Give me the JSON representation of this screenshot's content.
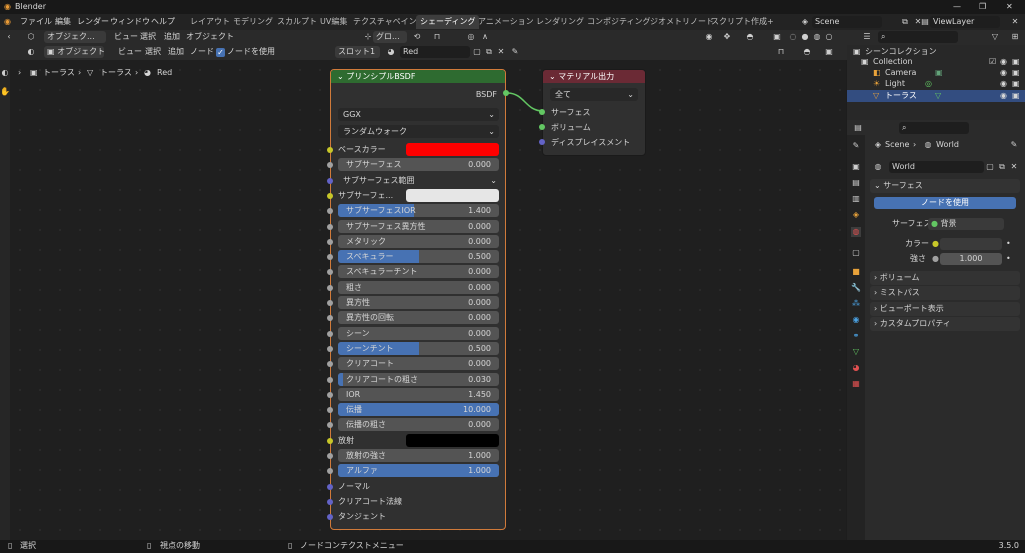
{
  "app": {
    "title": "Blender",
    "version": "3.5.0"
  },
  "menu": [
    "ファイル",
    "編集",
    "レンダー",
    "ウィンドウ",
    "ヘルプ"
  ],
  "workspaces": [
    "レイアウト",
    "モデリング",
    "スカルプト",
    "UV編集",
    "テクスチャペイント",
    "シェーディング",
    "アニメーション",
    "レンダリング",
    "コンポジティング",
    "ジオメトリノード",
    "スクリプト作成",
    "+"
  ],
  "scene_name": "Scene",
  "view_layer": "ViewLayer",
  "header1": {
    "mode": "オブジェク...",
    "view": "ビュー",
    "select": "選択",
    "add": "追加",
    "object": "オブジェクト",
    "transform": "グロ..."
  },
  "header2": {
    "type": "オブジェクト",
    "view": "ビュー",
    "select": "選択",
    "add": "追加",
    "node": "ノード",
    "use_nodes": "ノードを使用",
    "slot": "スロット1",
    "material": "Red"
  },
  "breadcrumb": [
    "トーラス",
    "トーラス",
    "Red"
  ],
  "bsdf": {
    "title": "プリンシプルBSDF",
    "output": "BSDF",
    "distribution": "GGX",
    "subsurface_method": "ランダムウォーク",
    "rows": [
      {
        "label": "ベースカラー",
        "kind": "color",
        "color": "#ff0000",
        "socket": "yellow"
      },
      {
        "label": "サブサーフェス",
        "value": "0.000",
        "fill": 0,
        "socket": "grey"
      },
      {
        "label": "サブサーフェス範囲",
        "kind": "vector",
        "socket": "purple"
      },
      {
        "label": "サブサーフェ...",
        "kind": "color",
        "color": "#e6e6e6",
        "socket": "yellow"
      },
      {
        "label": "サブサーフェスIOR",
        "value": "1.400",
        "fill": 0.47,
        "socket": "grey"
      },
      {
        "label": "サブサーフェス異方性",
        "value": "0.000",
        "fill": 0,
        "socket": "grey"
      },
      {
        "label": "メタリック",
        "value": "0.000",
        "fill": 0,
        "socket": "grey"
      },
      {
        "label": "スペキュラー",
        "value": "0.500",
        "fill": 0.5,
        "socket": "grey"
      },
      {
        "label": "スペキュラーチント",
        "value": "0.000",
        "fill": 0,
        "socket": "grey"
      },
      {
        "label": "粗さ",
        "value": "0.000",
        "fill": 0,
        "socket": "grey"
      },
      {
        "label": "異方性",
        "value": "0.000",
        "fill": 0,
        "socket": "grey"
      },
      {
        "label": "異方性の回転",
        "value": "0.000",
        "fill": 0,
        "socket": "grey"
      },
      {
        "label": "シーン",
        "value": "0.000",
        "fill": 0,
        "socket": "grey"
      },
      {
        "label": "シーンチント",
        "value": "0.500",
        "fill": 0.5,
        "socket": "grey"
      },
      {
        "label": "クリアコート",
        "value": "0.000",
        "fill": 0,
        "socket": "grey"
      },
      {
        "label": "クリアコートの粗さ",
        "value": "0.030",
        "fill": 0.03,
        "socket": "grey"
      },
      {
        "label": "IOR",
        "value": "1.450",
        "fill": 0,
        "socket": "grey"
      },
      {
        "label": "伝播",
        "value": "10.000",
        "fill": 1,
        "socket": "grey"
      },
      {
        "label": "伝播の粗さ",
        "value": "0.000",
        "fill": 0,
        "socket": "grey"
      },
      {
        "label": "放射",
        "kind": "color",
        "color": "#000000",
        "socket": "yellow"
      },
      {
        "label": "放射の強さ",
        "value": "1.000",
        "fill": 0,
        "socket": "grey"
      },
      {
        "label": "アルファ",
        "value": "1.000",
        "fill": 1,
        "socket": "grey"
      },
      {
        "label": "ノーマル",
        "kind": "vector",
        "socket": "purple"
      },
      {
        "label": "クリアコート法線",
        "kind": "vector",
        "socket": "purple"
      },
      {
        "label": "タンジェント",
        "kind": "vector",
        "socket": "purple"
      }
    ]
  },
  "output_node": {
    "title": "マテリアル出力",
    "target": "全て",
    "inputs": [
      "サーフェス",
      "ボリューム",
      "ディスプレイスメント"
    ]
  },
  "outliner": {
    "root": "シーンコレクション",
    "items": [
      "Collection",
      "Camera",
      "Light",
      "トーラス"
    ]
  },
  "properties": {
    "scene": "Scene",
    "world": "World",
    "world_field": "World",
    "surface_section": "サーフェス",
    "use_nodes_button": "ノードを使用",
    "surface_label": "サーフェス",
    "surface_value": "背景",
    "color_label": "カラー",
    "strength_label": "強さ",
    "strength_value": "1.000",
    "sections": [
      "ボリューム",
      "ミストパス",
      "ビューポート表示",
      "カスタムプロパティ"
    ]
  },
  "status": {
    "select": "選択",
    "pan": "視点の移動",
    "context": "ノードコンテクストメニュー"
  }
}
